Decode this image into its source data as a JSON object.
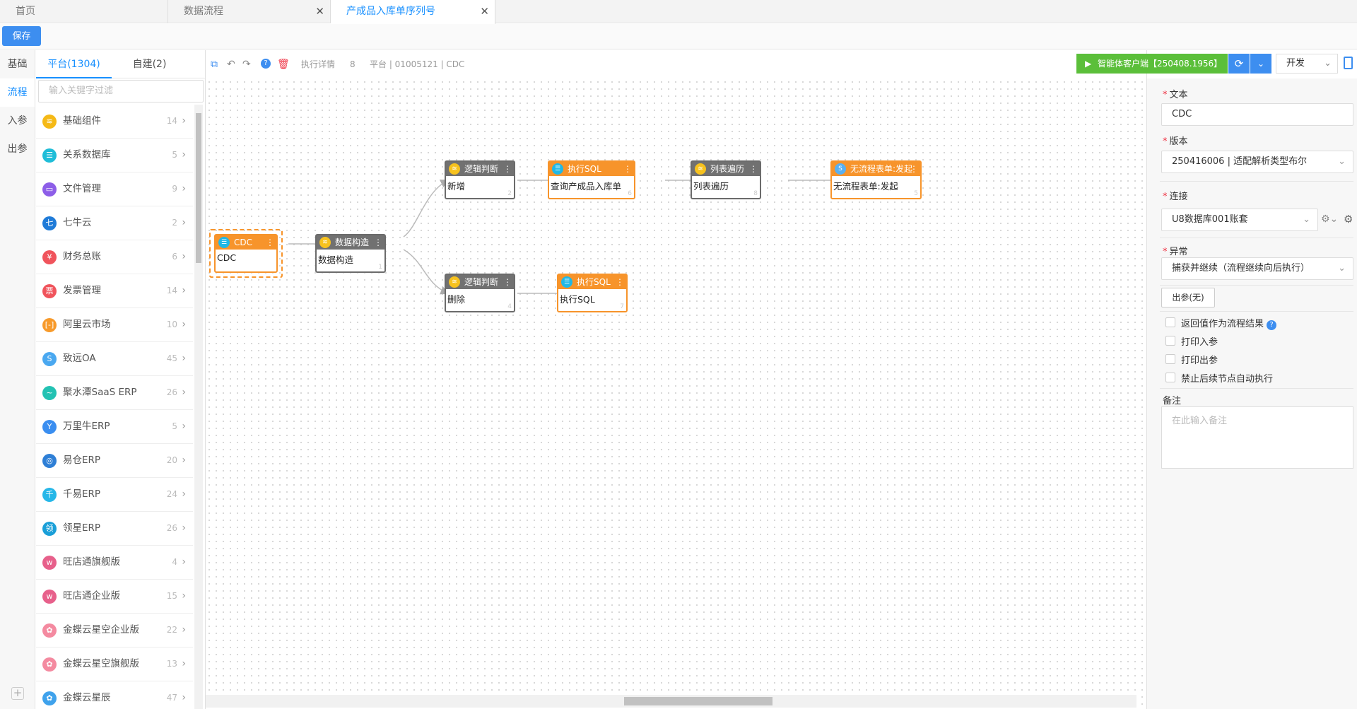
{
  "tabs": [
    {
      "label": "首页"
    },
    {
      "label": "数据流程"
    },
    {
      "label": "产成品入库单序列号"
    }
  ],
  "toolbar": {
    "save_label": "保存"
  },
  "vnav": {
    "items": [
      "基础",
      "流程",
      "入参",
      "出参"
    ],
    "active": "流程"
  },
  "component_panel": {
    "tabs": [
      "平台(1304)",
      "自建(2)"
    ],
    "filter_placeholder": "输入关键字过滤",
    "items": [
      {
        "label": "基础组件",
        "count": "14",
        "color": "#f5b916",
        "glyph": "≋"
      },
      {
        "label": "关系数据库",
        "count": "5",
        "color": "#1fbdd8",
        "glyph": "☰"
      },
      {
        "label": "文件管理",
        "count": "9",
        "color": "#8d5ee8",
        "glyph": "▭"
      },
      {
        "label": "七牛云",
        "count": "2",
        "color": "#1f7bd8",
        "glyph": "七"
      },
      {
        "label": "财务总账",
        "count": "6",
        "color": "#f0545c",
        "glyph": "¥"
      },
      {
        "label": "发票管理",
        "count": "14",
        "color": "#f0545c",
        "glyph": "票"
      },
      {
        "label": "阿里云市场",
        "count": "10",
        "color": "#f79a2b",
        "glyph": "[-]"
      },
      {
        "label": "致远OA",
        "count": "45",
        "color": "#4aa8f0",
        "glyph": "S"
      },
      {
        "label": "聚水潭SaaS ERP",
        "count": "26",
        "color": "#23c2b3",
        "glyph": "~"
      },
      {
        "label": "万里牛ERP",
        "count": "5",
        "color": "#3a8ef0",
        "glyph": "Y"
      },
      {
        "label": "易仓ERP",
        "count": "20",
        "color": "#2e7fd6",
        "glyph": "◎"
      },
      {
        "label": "千易ERP",
        "count": "24",
        "color": "#26b7e8",
        "glyph": "千"
      },
      {
        "label": "领星ERP",
        "count": "26",
        "color": "#1a9fd8",
        "glyph": "领"
      },
      {
        "label": "旺店通旗舰版",
        "count": "4",
        "color": "#e7608b",
        "glyph": "w"
      },
      {
        "label": "旺店通企业版",
        "count": "15",
        "color": "#e7608b",
        "glyph": "w"
      },
      {
        "label": "金蝶云星空企业版",
        "count": "22",
        "color": "#f48aa0",
        "glyph": "✿"
      },
      {
        "label": "金蝶云星空旗舰版",
        "count": "13",
        "color": "#f48aa0",
        "glyph": "✿"
      },
      {
        "label": "金蝶云星辰",
        "count": "47",
        "color": "#3fa2ec",
        "glyph": "✿"
      }
    ]
  },
  "canvas_toolbar": {
    "exec_detail": "执行详情",
    "exec_count": "8",
    "platform_info": "平台 | 01005121 | CDC"
  },
  "nodes": [
    {
      "title": "CDC",
      "body": "CDC",
      "index": "",
      "theme": "orange",
      "icon": "cyan"
    },
    {
      "title": "数据构造",
      "body": "数据构造",
      "index": "1",
      "theme": "gray",
      "icon": "yellow"
    },
    {
      "title": "逻辑判断",
      "body": "新增",
      "index": "2",
      "theme": "gray",
      "icon": "yellow"
    },
    {
      "title": "执行SQL",
      "body": "查询产成品入库单",
      "index": "6",
      "theme": "orange",
      "icon": "cyan"
    },
    {
      "title": "列表遍历",
      "body": "列表遍历",
      "index": "8",
      "theme": "gray",
      "icon": "yellow"
    },
    {
      "title": "无流程表单:发起",
      "body": "无流程表单:发起",
      "index": "5",
      "theme": "orange",
      "icon": "blue"
    },
    {
      "title": "逻辑判断",
      "body": "删除",
      "index": "4",
      "theme": "gray",
      "icon": "yellow"
    },
    {
      "title": "执行SQL",
      "body": "执行SQL",
      "index": "7",
      "theme": "orange",
      "icon": "cyan"
    }
  ],
  "right_toolbar": {
    "run_label": "智能体客户端【250408.1956】",
    "mode_value": "开发"
  },
  "properties": {
    "text_label": "文本",
    "text_value": "CDC",
    "version_label": "版本",
    "version_value": "250416006 | 适配解析类型布尔",
    "connection_label": "连接",
    "connection_value": "U8数据库001账套",
    "exception_label": "异常",
    "exception_value": "捕获并继续（流程继续向后执行）",
    "output_button": "出参(无)",
    "checkboxes": [
      "返回值作为流程结果",
      "打印入参",
      "打印出参",
      "禁止后续节点自动执行"
    ],
    "remark_label": "备注",
    "remark_placeholder": "在此输入备注"
  }
}
